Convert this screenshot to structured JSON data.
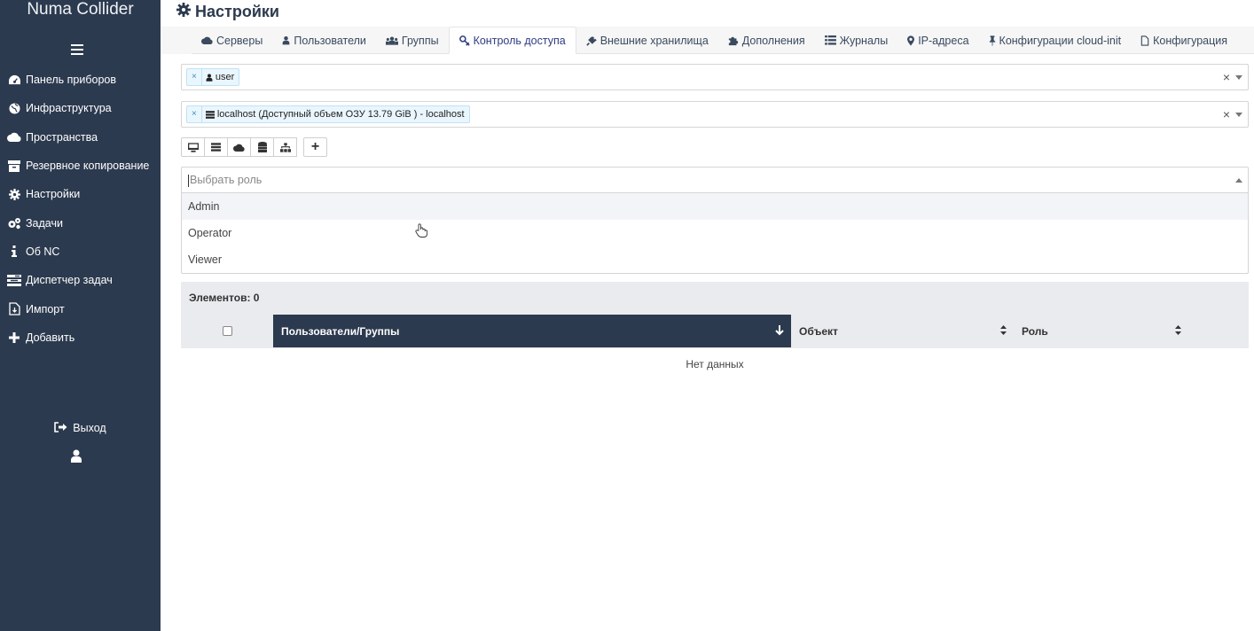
{
  "brand": "Numa Collider",
  "sidebar": {
    "items": [
      {
        "label": "Панель приборов",
        "icon": "dashboard-icon"
      },
      {
        "label": "Инфраструктура",
        "icon": "globe-icon"
      },
      {
        "label": "Пространства",
        "icon": "cloud-icon"
      },
      {
        "label": "Резервное копирование",
        "icon": "archive-icon"
      },
      {
        "label": "Настройки",
        "icon": "gear-icon"
      },
      {
        "label": "Задачи",
        "icon": "gears-icon"
      },
      {
        "label": "Об NC",
        "icon": "info-icon"
      },
      {
        "label": "Диспетчер задач",
        "icon": "tasks-icon"
      },
      {
        "label": "Импорт",
        "icon": "import-icon"
      },
      {
        "label": "Добавить",
        "icon": "plus-icon"
      }
    ],
    "logout": "Выход"
  },
  "header": {
    "title": "Настройки"
  },
  "tabs": [
    {
      "label": "Серверы",
      "icon": "cloud-icon"
    },
    {
      "label": "Пользователи",
      "icon": "user-icon"
    },
    {
      "label": "Группы",
      "icon": "users-icon"
    },
    {
      "label": "Контроль доступа",
      "icon": "key-icon",
      "active": true
    },
    {
      "label": "Внешние хранилища",
      "icon": "plug-icon"
    },
    {
      "label": "Дополнения",
      "icon": "puzzle-icon"
    },
    {
      "label": "Журналы",
      "icon": "list-icon"
    },
    {
      "label": "IP-адреса",
      "icon": "map-marker-icon"
    },
    {
      "label": "Конфигурации cloud-init",
      "icon": "pin-icon"
    },
    {
      "label": "Конфигурация",
      "icon": "file-icon"
    }
  ],
  "subject_select": {
    "chip": "user"
  },
  "object_select": {
    "chip": "localhost (Доступный объем ОЗУ 13.79 GiB ) - localhost"
  },
  "toolbar": {
    "plus": "+"
  },
  "role_select": {
    "placeholder": "Выбрать роль",
    "options": [
      "Admin",
      "Operator",
      "Viewer"
    ],
    "highlighted": "Admin"
  },
  "table": {
    "count_label": "Элементов: 0",
    "columns": [
      "Пользователи/Группы",
      "Объект",
      "Роль"
    ],
    "empty": "Нет данных"
  },
  "colors": {
    "sidebar": "#2c3a4f",
    "accent": "#2f3c80",
    "chip_bg": "#eaf6fd"
  }
}
